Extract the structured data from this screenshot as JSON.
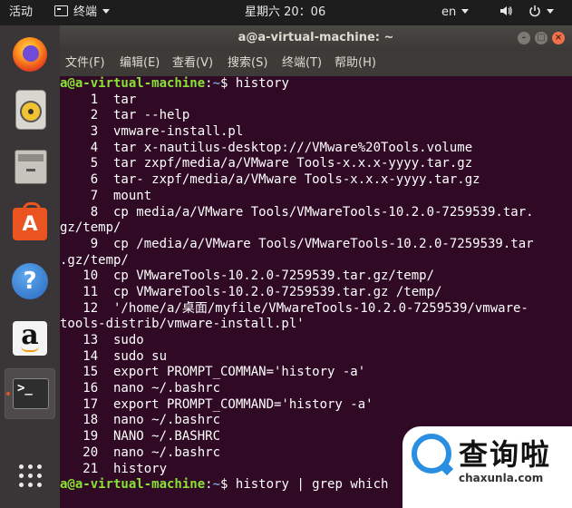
{
  "topbar": {
    "activities": "活动",
    "app_menu": "终端",
    "clock": "星期六 20：06",
    "language": "en"
  },
  "dock": {
    "items": [
      {
        "name": "firefox-icon"
      },
      {
        "name": "rhythmbox-icon"
      },
      {
        "name": "files-icon"
      },
      {
        "name": "ubuntu-software-icon",
        "glyph": "A"
      },
      {
        "name": "help-icon",
        "glyph": "?"
      },
      {
        "name": "amazon-icon",
        "glyph": "a"
      },
      {
        "name": "terminal-icon",
        "glyph": ">_"
      },
      {
        "name": "show-applications-icon"
      }
    ],
    "accent": "#e95420"
  },
  "window": {
    "title": "a@a-virtual-machine: ~",
    "menu": [
      "文件(F)",
      "编辑(E)",
      "查看(V)",
      "搜索(S)",
      "终端(T)",
      "帮助(H)"
    ]
  },
  "terminal": {
    "prompt_user": "a@a-virtual-machine",
    "prompt_path": "~",
    "prompt_sep": ":",
    "prompt_end": "$ ",
    "first_command": "history",
    "history": [
      "    1  tar",
      "    2  tar --help",
      "    3  vmware-install.pl",
      "    4  tar x-nautilus-desktop:///VMware%20Tools.volume",
      "    5  tar zxpf/media/a/VMware Tools-x.x.x-yyyy.tar.gz",
      "    6  tar- zxpf/media/a/VMware Tools-x.x.x-yyyy.tar.gz",
      "    7  mount",
      "    8  cp media/a/VMware Tools/VMwareTools-10.2.0-7259539.tar.",
      "gz/temp/",
      "    9  cp /media/a/VMware Tools/VMwareTools-10.2.0-7259539.tar",
      ".gz/temp/",
      "   10  cp VMwareTools-10.2.0-7259539.tar.gz/temp/",
      "   11  cp VMwareTools-10.2.0-7259539.tar.gz /temp/",
      "   12  '/home/a/桌面/myfile/VMwareTools-10.2.0-7259539/vmware-",
      "tools-distrib/vmware-install.pl'",
      "   13  sudo",
      "   14  sudo su",
      "   15  export PROMPT_COMMAN='history -a'",
      "   16  nano ~/.bashrc",
      "   17  export PROMPT_COMMAND='history -a'",
      "   18  nano ~/.bashrc",
      "   19  NANO ~/.BASHRC",
      "   20  nano ~/.bashrc",
      "   21  history"
    ],
    "current_command": "history | grep which",
    "colors": {
      "background": "#300a24",
      "user": "#8ae234",
      "path": "#729fcf",
      "text": "#ffffff"
    }
  },
  "watermark": {
    "brand_cn": "查询啦",
    "brand_url": "chaxunla.com"
  }
}
